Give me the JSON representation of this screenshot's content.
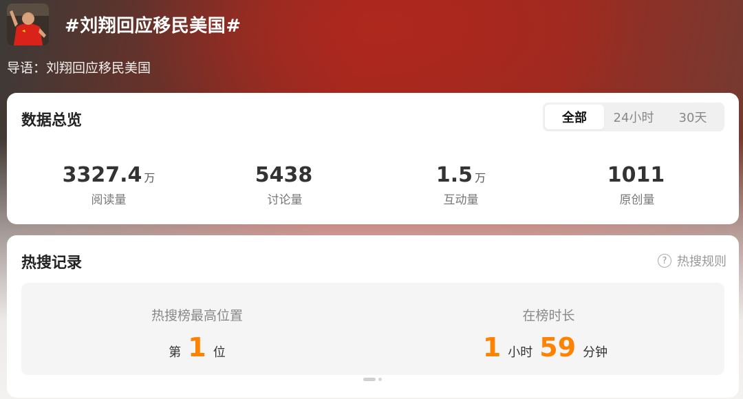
{
  "header": {
    "title": "#刘翔回应移民美国#",
    "guide": "导语：刘翔回应移民美国"
  },
  "overview": {
    "title": "数据总览",
    "tabs": [
      {
        "label": "全部",
        "active": true
      },
      {
        "label": "24小时",
        "active": false
      },
      {
        "label": "30天",
        "active": false
      }
    ],
    "stats": [
      {
        "value": "3327.4",
        "unit": "万",
        "label": "阅读量"
      },
      {
        "value": "5438",
        "unit": "",
        "label": "讨论量"
      },
      {
        "value": "1.5",
        "unit": "万",
        "label": "互动量"
      },
      {
        "value": "1011",
        "unit": "",
        "label": "原创量"
      }
    ]
  },
  "records": {
    "title": "热搜记录",
    "rules_label": "热搜规则",
    "rules_icon": "question-circle-icon",
    "highest_position": {
      "label": "热搜榜最高位置",
      "prefix": "第",
      "value": "1",
      "suffix": "位"
    },
    "duration": {
      "label": "在榜时长",
      "hours": "1",
      "hours_unit": "小时",
      "minutes": "59",
      "minutes_unit": "分钟"
    }
  },
  "colors": {
    "accent_orange": "#ff8200",
    "header_red": "#a2281f"
  }
}
